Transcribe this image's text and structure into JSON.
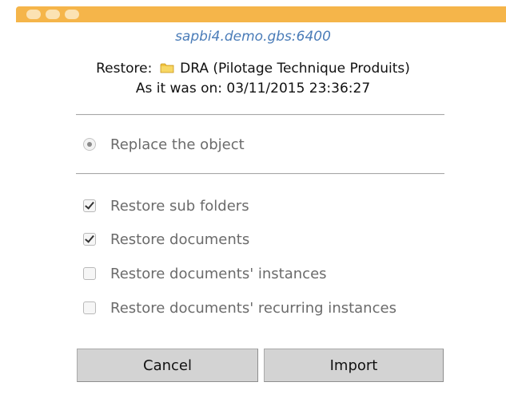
{
  "window": {
    "server": "sapbi4.demo.gbs:6400"
  },
  "restore": {
    "prefix": "Restore:",
    "object_name": "DRA (Pilotage Technique Produits)",
    "object_icon": "folder-icon",
    "as_of": "As it was on: 03/11/2015 23:36:27"
  },
  "options": {
    "replace": {
      "label": "Replace the object",
      "selected": true
    },
    "sub_folders": {
      "label": "Restore sub folders",
      "checked": true
    },
    "documents": {
      "label": "Restore documents",
      "checked": true
    },
    "instances": {
      "label": "Restore documents' instances",
      "checked": false
    },
    "recurring": {
      "label": "Restore documents' recurring instances",
      "checked": false
    }
  },
  "buttons": {
    "cancel": "Cancel",
    "import": "Import"
  },
  "colors": {
    "titlebar": "#f5b54a",
    "server_text": "#4a7cb8",
    "button_bg": "#d3d3d3"
  }
}
